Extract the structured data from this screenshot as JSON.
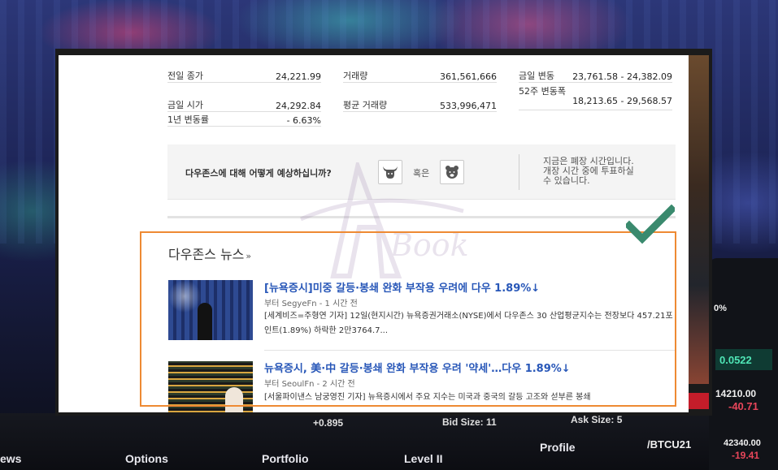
{
  "stats": {
    "prev_close_label": "전일 종가",
    "prev_close_value": "24,221.99",
    "open_label": "금일 시가",
    "open_value": "24,292.84",
    "year_change_label": "1년 변동률",
    "year_change_value": "- 6.63%",
    "volume_label": "거래량",
    "volume_value": "361,561,666",
    "avg_volume_label": "평균 거래량",
    "avg_volume_value": "533,996,471",
    "day_range_label": "금일 변동",
    "day_range_value": "23,761.58 - 24,382.09",
    "week52_label": "52주 변동폭",
    "week52_value": "18,213.65 - 29,568.57"
  },
  "poll": {
    "question": "다우존스에 대해 어떻게 예상하십니까?",
    "or_text": "혹은",
    "note_line1": "지금은 폐장 시간입니다.",
    "note_line2": "개장 시간 중에 투표하실",
    "note_line3": "수 있습니다."
  },
  "news": {
    "section_title": "다우존스 뉴스",
    "section_arrow": "»",
    "items": [
      {
        "headline": "[뉴욕증시]미중 갈등·봉쇄 완화 부작용 우려에 다우 1.89%↓",
        "source": "부터 SegyeFn - 1 시간 전",
        "snippet": "[세계비즈=주형연 기자] 12일(현지시간) 뉴욕증권거래소(NYSE)에서 다우존스 30 산업평균지수는 전장보다 457.21포인트(1.89%) 하락한 2만3764.7..."
      },
      {
        "headline": "뉴욕증시, 美·中 갈등·봉쇄 완화 부작용 우려 '약세'…다우 1.89%↓",
        "source": "부터 SeoulFn - 2 시간 전",
        "snippet": "[서울파이낸스 남궁영진 기자] 뉴욕증시에서 주요 지수는 미국과 중국의 갈등 고조와 섣부른 봉쇄"
      }
    ]
  },
  "watermark": {
    "text": "Book"
  },
  "background": {
    "options_label": "Options",
    "portfolio_label": "Portfolio",
    "level_label": "Level II",
    "profile_label": "Profile",
    "ticker_label": "/BTCU21",
    "price_1": "14210.00",
    "change_1": "-40.71",
    "price_2": "42340.00",
    "change_2": "-19.41",
    "green_value": "0.0522",
    "percent_value": "0%",
    "delta_value": "+0.895",
    "bid_size": "Bid Size: 11",
    "ask_size": "Ask Size: 5"
  },
  "colors": {
    "headline_blue": "#2857b8",
    "highlight_orange": "#ee8a33",
    "check_green": "#3a8a6e"
  }
}
